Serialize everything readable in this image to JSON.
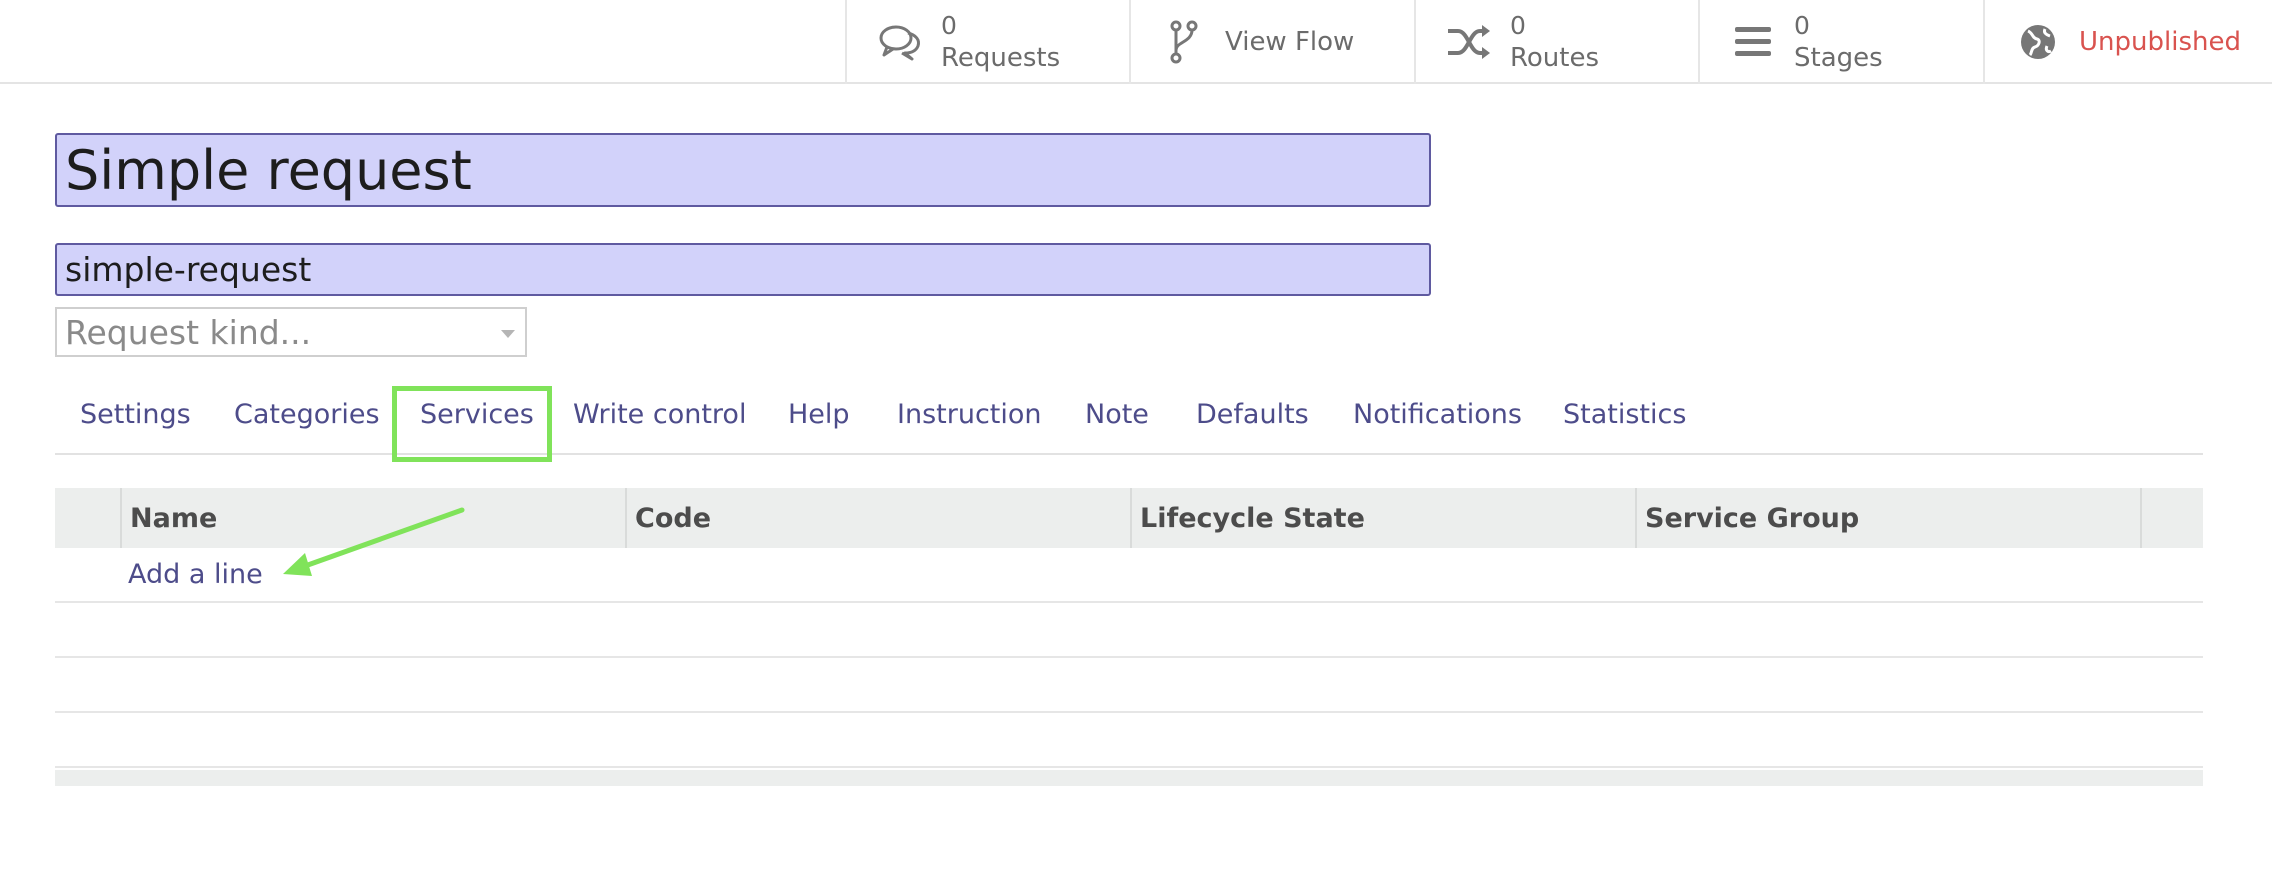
{
  "statbar": {
    "requests": {
      "count": "0",
      "label": "Requests"
    },
    "view_flow": {
      "label": "View Flow"
    },
    "routes": {
      "count": "0",
      "label": "Routes"
    },
    "stages": {
      "count": "0",
      "label": "Stages"
    },
    "publish": {
      "label": "Unpublished"
    }
  },
  "form": {
    "title_value": "Simple request",
    "code_value": "simple-request",
    "kind_placeholder": "Request kind..."
  },
  "tabs": [
    {
      "label": "Settings"
    },
    {
      "label": "Categories"
    },
    {
      "label": "Services",
      "active": true
    },
    {
      "label": "Write control"
    },
    {
      "label": "Help"
    },
    {
      "label": "Instruction"
    },
    {
      "label": "Note"
    },
    {
      "label": "Defaults"
    },
    {
      "label": "Notifications"
    },
    {
      "label": "Statistics"
    }
  ],
  "table": {
    "columns": [
      "Name",
      "Code",
      "Lifecycle State",
      "Service Group"
    ],
    "add_line": "Add a line"
  },
  "colors": {
    "accent": "#4d4c8a",
    "input_bg": "#d2d2fa",
    "highlight": "#80e35a",
    "unpublished": "#d9534f"
  },
  "icons": {
    "requests": "speech-bubbles-icon",
    "view_flow": "branch-icon",
    "routes": "shuffle-icon",
    "stages": "list-bars-icon",
    "publish": "globe-icon"
  }
}
